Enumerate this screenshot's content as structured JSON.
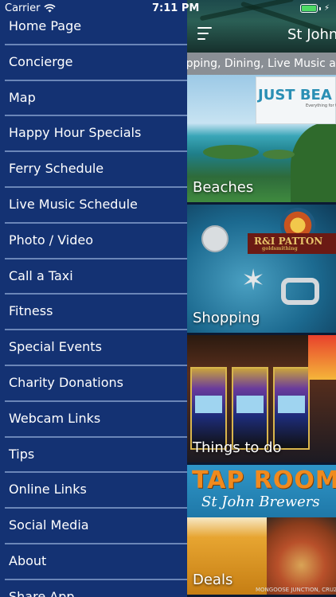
{
  "status_bar": {
    "carrier": "Carrier",
    "time": "7:11 PM",
    "battery_level": 1.0,
    "battery_color": "#4cd964"
  },
  "header": {
    "title": "St John",
    "menu_icon": "hamburger-icon"
  },
  "ticker": {
    "text": "opping, Dining, Live Music an"
  },
  "tiles": [
    {
      "label": "Beaches",
      "sign": "JUST BEA",
      "sign_sub": "Everything for the Beach & Clothing Boutique"
    },
    {
      "label": "Shopping",
      "banner": "R&I PATTON",
      "banner_sub": "goldsmithing"
    },
    {
      "label": "Things to do"
    },
    {
      "label": "Deals",
      "banner": "TAP ROOM",
      "banner_sub": "St John Brewers",
      "footer": "MONGOOSE JUNCTION, CRUZ BAY ST JOHN"
    }
  ],
  "drawer": {
    "items": [
      {
        "label": "Home Page"
      },
      {
        "label": "Concierge"
      },
      {
        "label": "Map"
      },
      {
        "label": "Happy Hour Specials"
      },
      {
        "label": "Ferry Schedule"
      },
      {
        "label": "Live Music Schedule"
      },
      {
        "label": "Photo / Video"
      },
      {
        "label": "Call a Taxi"
      },
      {
        "label": "Fitness"
      },
      {
        "label": "Special Events"
      },
      {
        "label": "Charity Donations"
      },
      {
        "label": "Webcam Links"
      },
      {
        "label": "Tips"
      },
      {
        "label": "Online Links"
      },
      {
        "label": "Social Media"
      },
      {
        "label": "About"
      },
      {
        "label": "Share App"
      }
    ]
  },
  "colors": {
    "drawer_bg": "#143273",
    "divider": "#6b86b8",
    "ticker_bg": "#8a8f95"
  }
}
